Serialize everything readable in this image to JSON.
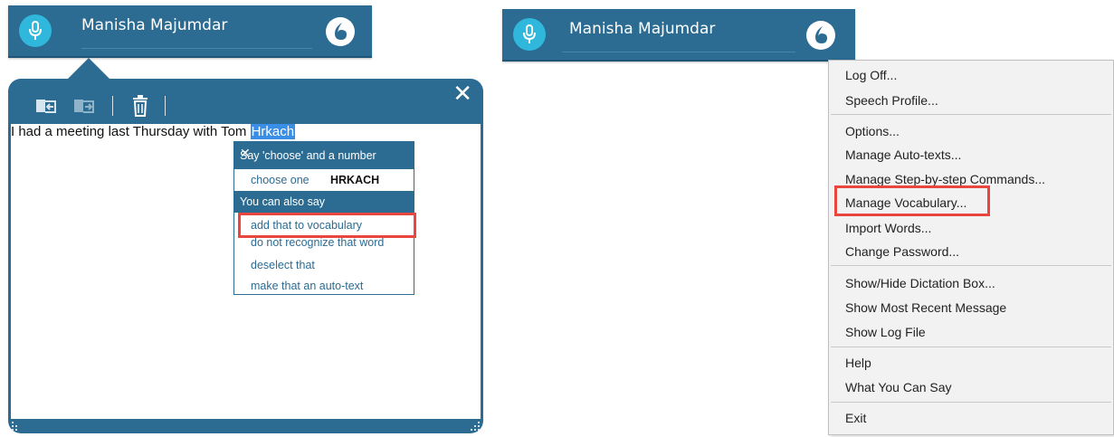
{
  "left_bar": {
    "user_name": "Manisha Majumdar"
  },
  "right_bar": {
    "user_name": "Manisha Majumdar"
  },
  "dictation_box": {
    "close_label": "✕",
    "text_before": "I had a meeting last Thursday with Tom ",
    "text_selected": "Hrkach"
  },
  "correction_popup": {
    "header": "Say 'choose' and a number",
    "close_label": "✕",
    "choose_label": "choose one",
    "choice_word": "HRKACH",
    "also_header": "You can also say",
    "options": [
      "add that to vocabulary",
      "do not recognize that word",
      "deselect that",
      "make that an auto-text"
    ]
  },
  "context_menu": {
    "items": [
      "Log Off...",
      "Speech Profile...",
      "Options...",
      "Manage Auto-texts...",
      "Manage Step-by-step Commands...",
      "Manage Vocabulary...",
      "Import Words...",
      "Change Password...",
      "Show/Hide Dictation Box...",
      "Show Most Recent Message",
      "Show Log File",
      "Help",
      "What You Can Say",
      "Exit"
    ]
  },
  "colors": {
    "bar": "#2c6b92",
    "mic": "#2fb8dc",
    "highlight": "#e8463e",
    "selection": "#3a8ee6"
  }
}
